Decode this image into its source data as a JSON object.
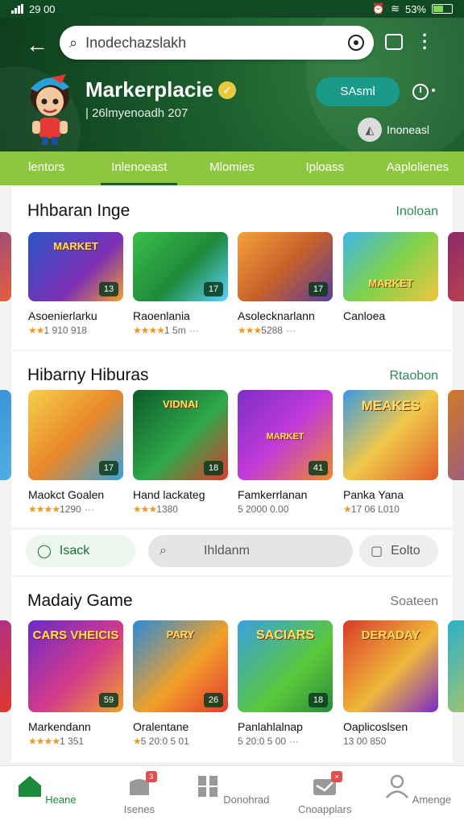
{
  "status": {
    "time": "29 00",
    "battery": "53%"
  },
  "header": {
    "search_text": "Inodechazslakh",
    "title": "Markerplacie",
    "subtitle": "| 26lmyenoadh 207",
    "action_label": "SAsml",
    "user_label": "Inoneasl"
  },
  "tabs": [
    "lentors",
    "Inlenoeast",
    "Mlomies",
    "Iploass",
    "Aaplolienes"
  ],
  "sections": [
    {
      "title": "Hhbaran Inge",
      "link": "Inoloan",
      "cards": [
        {
          "name": "Asoenierlarku",
          "rating": "1 910 918",
          "stars": "★★",
          "badge": "13",
          "art": "MARKET"
        },
        {
          "name": "Raoenlania",
          "rating": "1 5m",
          "stars": "★★★★",
          "badge": "17",
          "art": ""
        },
        {
          "name": "Asolecknarlann",
          "rating": "5288",
          "stars": "★★★",
          "badge": "17",
          "art": ""
        },
        {
          "name": "Canloea",
          "rating": "",
          "stars": "",
          "badge": "",
          "art": "MARKET"
        }
      ]
    },
    {
      "title": "Hibarny Hiburas",
      "link": "Rtaobon",
      "cards": [
        {
          "name": "Maokct Goalen",
          "rating": "1290",
          "stars": "★★★★",
          "badge": "17",
          "art": ""
        },
        {
          "name": "Hand lackateg",
          "rating": "1380",
          "stars": "★★★",
          "badge": "18",
          "art": "VIDNAI"
        },
        {
          "name": "Famkerrlanan",
          "rating": "5 2000 0.00",
          "stars": "",
          "badge": "41",
          "art": "MARKET"
        },
        {
          "name": "Panka Yana",
          "rating": "17 06 L010",
          "stars": "★",
          "badge": "",
          "art": "MEAKES"
        }
      ]
    },
    {
      "title": "Madaiy Game",
      "link": "Soateen",
      "cards": [
        {
          "name": "Markendann",
          "rating": "1 351",
          "stars": "★★★★",
          "badge": "59",
          "art": "CARS VHEICIS"
        },
        {
          "name": "Oralentane",
          "rating": "5 20:0 5 01",
          "stars": "★",
          "badge": "26",
          "art": "PARY"
        },
        {
          "name": "Panlahlalnap",
          "rating": "5 20:0 5 00",
          "stars": "",
          "badge": "18",
          "art": "SACIARS"
        },
        {
          "name": "Oaplicoslsen",
          "rating": "13 00 850",
          "stars": "",
          "badge": "",
          "art": "DERADAY"
        }
      ]
    }
  ],
  "toolbar": {
    "primary": "Isack",
    "search": "Ihldanm",
    "secondary": "Eolto"
  },
  "bottom_nav": [
    "Heane",
    "Isenes",
    "Donohrad",
    "Cnoapplars",
    "Amenge"
  ],
  "colors": {
    "header": "#1b5e2d",
    "tabs": "#8dc63f",
    "accent": "#2e8b57"
  }
}
